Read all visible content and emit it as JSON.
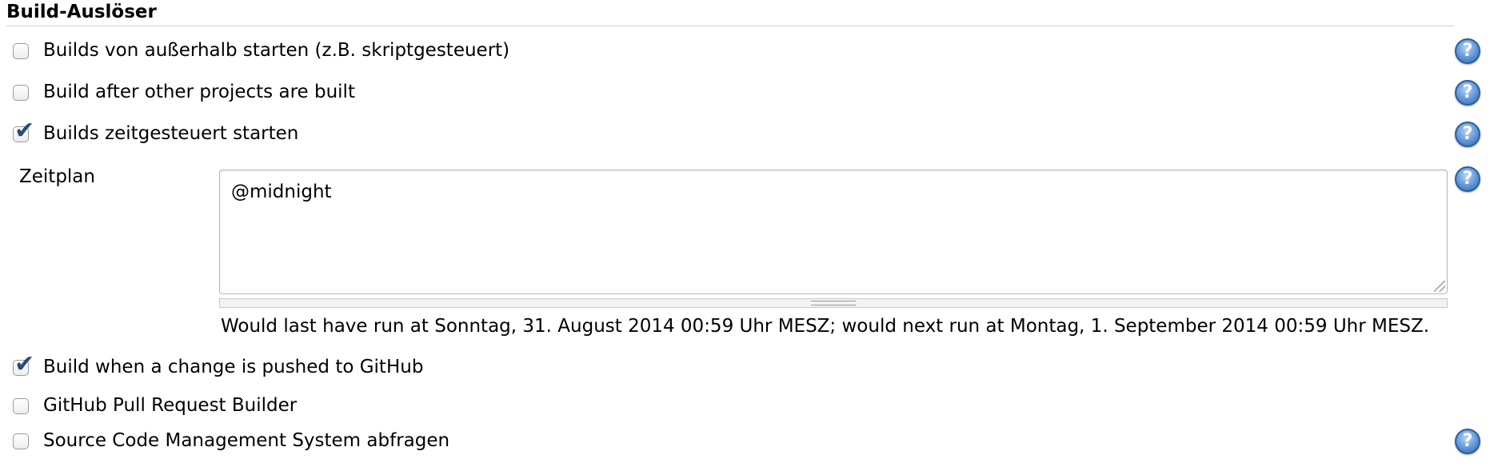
{
  "section": {
    "title": "Build-Auslöser"
  },
  "triggers": [
    {
      "label": "Builds von außerhalb starten (z.B. skriptgesteuert)",
      "checked": false,
      "help": true
    },
    {
      "label": "Build after other projects are built",
      "checked": false,
      "help": true
    },
    {
      "label": "Builds zeitgesteuert starten",
      "checked": true,
      "help": true
    },
    {
      "label": "Build when a change is pushed to GitHub",
      "checked": true,
      "help": false
    },
    {
      "label": "GitHub Pull Request Builder",
      "checked": false,
      "help": false
    },
    {
      "label": "Source Code Management System abfragen",
      "checked": false,
      "help": true
    }
  ],
  "schedule": {
    "label": "Zeitplan",
    "value": "@midnight",
    "info": "Would last have run at Sonntag, 31. August 2014 00:59 Uhr MESZ; would next run at Montag, 1. September 2014 00:59 Uhr MESZ."
  },
  "icons": {
    "checkmark": "✔",
    "help": "?"
  },
  "colors": {
    "help_blue": "#2f62a8",
    "check_blue": "#2a4a7a"
  }
}
